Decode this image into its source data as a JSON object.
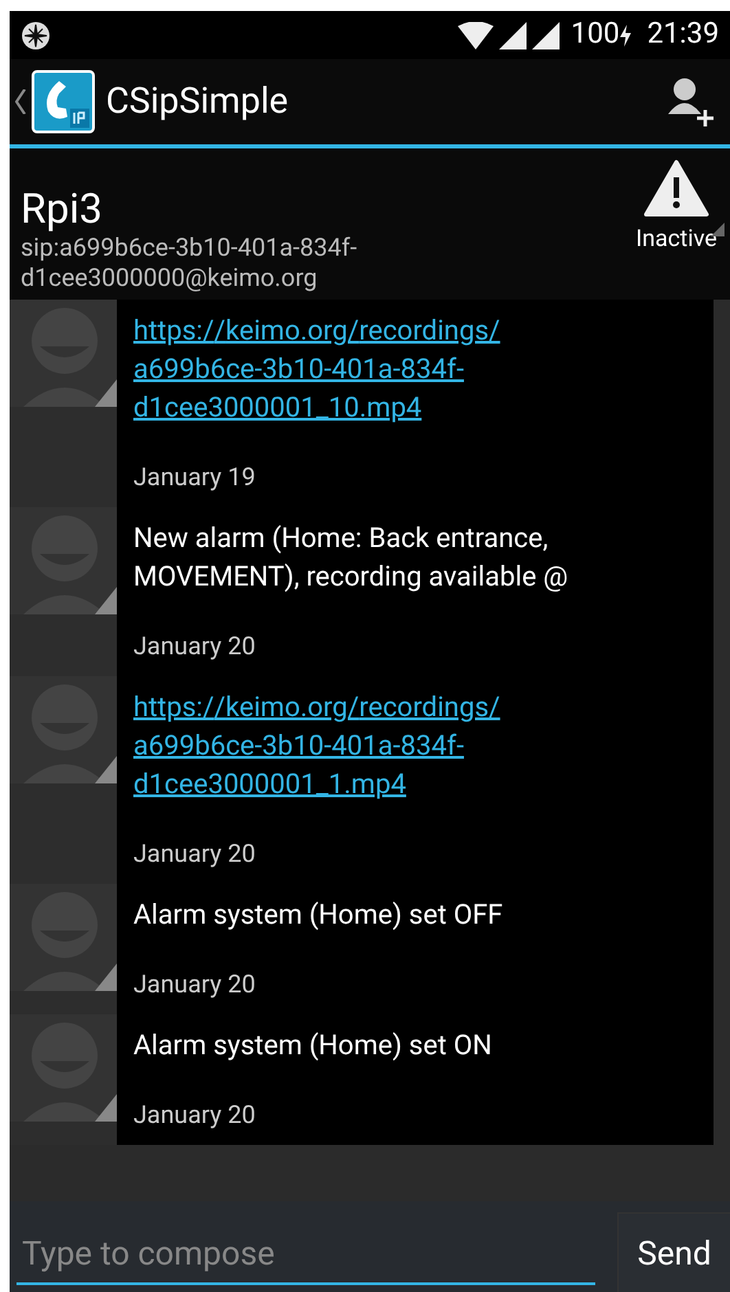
{
  "status_bar": {
    "battery": "100",
    "time": "21:39"
  },
  "app_bar": {
    "title": "CSipSimple"
  },
  "contact": {
    "name": "Rpi3",
    "address": "sip:a699b6ce-3b10-401a-834f-d1cee3000000@keimo.org",
    "account_status": "Inactive"
  },
  "messages": [
    {
      "kind": "link",
      "text": "https://keimo.org/recordings/a699b6ce-3b10-401a-834f-d1cee3000001_10.mp4",
      "date": "January 19"
    },
    {
      "kind": "text",
      "text": "New alarm (Home: Back entrance, MOVEMENT), recording available @",
      "date": "January 20"
    },
    {
      "kind": "link",
      "text": "https://keimo.org/recordings/a699b6ce-3b10-401a-834f-d1cee3000001_1.mp4",
      "date": "January 20"
    },
    {
      "kind": "text",
      "text": "Alarm system (Home) set OFF",
      "date": "January 20"
    },
    {
      "kind": "text",
      "text": "Alarm system (Home) set ON",
      "date": "January 20"
    }
  ],
  "compose": {
    "placeholder": "Type to compose",
    "send": "Send"
  }
}
